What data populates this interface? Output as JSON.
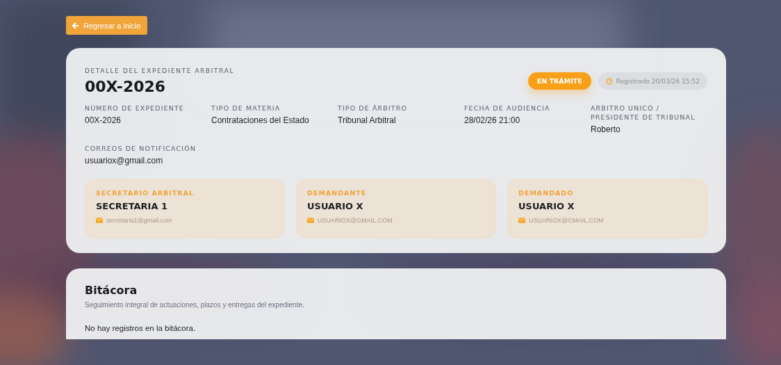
{
  "back_button": {
    "label": "Regresar a inicio"
  },
  "detail": {
    "eyebrow": "DETALLE DEL EXPEDIENTE ARBITRAL",
    "title": "00X-2026",
    "status": "EN TRÁMITE",
    "registered": "Registrado 20/03/26 15:52",
    "fields": [
      {
        "label": "NÚMERO DE EXPEDIENTE",
        "value": "00X-2026"
      },
      {
        "label": "TIPO DE MATERIA",
        "value": "Contrataciones del Estado"
      },
      {
        "label": "TIPO DE ÁRBITRO",
        "value": "Tribunal Arbitral"
      },
      {
        "label": "FECHA DE AUDIENCIA",
        "value": "28/02/26 21:00"
      },
      {
        "label": "ARBITRO UNICO / PRESIDENTE DE TRIBUNAL",
        "value": "Roberto"
      },
      {
        "label": "CORREOS DE NOTIFICACIÓN",
        "value": "usuariox@gmail.com"
      }
    ],
    "parties": [
      {
        "role": "SECRETARIO ARBITRAL",
        "name": "SECRETARIA 1",
        "email": "secretaria1@gmail.com"
      },
      {
        "role": "DEMANDANTE",
        "name": "USUARIO X",
        "email": "USUARIOX@GMAIL.COM"
      },
      {
        "role": "DEMANDADO",
        "name": "USUARIO X",
        "email": "USUARIOX@GMAIL.COM"
      }
    ]
  },
  "log": {
    "title": "Bitácora",
    "subtitle": "Seguimiento integral de actuaciones, plazos y entregas del expediente.",
    "empty": "No hay registros en la bitácora."
  }
}
